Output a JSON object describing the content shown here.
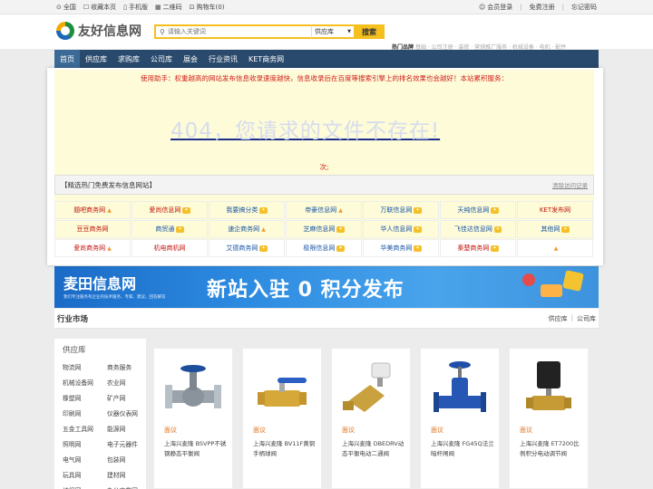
{
  "topbar": {
    "left": [
      "全国",
      "收藏本页",
      "手机版",
      "二维码",
      "购物车(0)"
    ],
    "right": [
      "会员登录",
      "免费注册",
      "忘记密码"
    ]
  },
  "header": {
    "logo_text": "友好信息网",
    "search_placeholder": "请输入关键词",
    "search_scope": "供应库",
    "search_button": "搜索",
    "hot_label": "热门品牌",
    "hot_keywords": "基础 · 公司注册 · 装修 · 营销推广服务 · 机械设备 · 电机 · 配件"
  },
  "nav": [
    "首页",
    "供应库",
    "求购库",
    "公司库",
    "展会",
    "行业资讯",
    "KET商务网"
  ],
  "notice": {
    "assist_text": "使用助手：权重越高的网站发布信息收录速度越快，信息收录后在百度等搜索引擎上的排名效果也会越好！本站累积服务：",
    "error_text": "404，您请求的文件不存在!",
    "count_text": "次;",
    "rec_title": "【精选热门免费发布信息网站】",
    "rec_clear": "清除访问记录"
  },
  "sites": [
    {
      "name": "题吧商务网",
      "mark": "up",
      "color": "red"
    },
    {
      "name": "爱尚信息网",
      "mark": "vip",
      "color": "red"
    },
    {
      "name": "我要搞分类",
      "mark": "vip",
      "color": "blue"
    },
    {
      "name": "帝豪信息网",
      "mark": "up",
      "color": "blue"
    },
    {
      "name": "万联信息网",
      "mark": "vip",
      "color": "blue"
    },
    {
      "name": "天纯信息网",
      "mark": "vip",
      "color": "blue"
    },
    {
      "name": "KET发布网",
      "mark": "",
      "color": "red"
    },
    {
      "name": "豆豆商务网",
      "mark": "",
      "color": "red"
    },
    {
      "name": "商贸通",
      "mark": "vip",
      "color": "blue"
    },
    {
      "name": "速企商务网",
      "mark": "up",
      "color": "blue"
    },
    {
      "name": "芝麻信息网",
      "mark": "vip",
      "color": "blue"
    },
    {
      "name": "华人信息网",
      "mark": "vip",
      "color": "blue"
    },
    {
      "name": "飞佳达信息网",
      "mark": "vip",
      "color": "blue"
    },
    {
      "name": "其他网",
      "mark": "vip",
      "color": "blue"
    },
    {
      "name": "爱尚商务网",
      "mark": "up",
      "color": "red"
    },
    {
      "name": "机电商机网",
      "mark": "",
      "color": "red"
    },
    {
      "name": "艾德商务网",
      "mark": "vip",
      "color": "blue"
    },
    {
      "name": "极限信息网",
      "mark": "vip",
      "color": "blue"
    },
    {
      "name": "华美商务网",
      "mark": "vip",
      "color": "blue"
    },
    {
      "name": "秦楚商务网",
      "mark": "vip",
      "color": "red"
    },
    {
      "name": "",
      "mark": "up",
      "color": "red"
    }
  ],
  "banner": {
    "brand": "麦田信息网",
    "tag": "我们专注服务有企业的技术服务、专家、建议、回答解答",
    "slogan_a": "新站入驻 ",
    "slogan_b": "0",
    "slogan_c": " 积分发布"
  },
  "market": {
    "title": "行业市场",
    "links": [
      "供应库",
      "公司库"
    ]
  },
  "sidebar": {
    "title": "供应库",
    "cats": [
      "物流网",
      "商务服务",
      "机械设备网",
      "农业网",
      "橡塑网",
      "矿产网",
      "印刷网",
      "仪器仪表网",
      "五金工具网",
      "能源网",
      "照明网",
      "电子元器件",
      "电气网",
      "包装网",
      "玩具网",
      "建材网",
      "纺织网",
      "办公文教网"
    ]
  },
  "products": [
    {
      "price": "面议",
      "name": "上海兴麦隆 BSVPP不锈钢静态平衡阀",
      "icon": "valve-flange-icon"
    },
    {
      "price": "面议",
      "name": "上海兴麦隆 BV11F黄铜手柄球阀",
      "icon": "ball-valve-icon"
    },
    {
      "price": "面议",
      "name": "上海兴麦隆 DBEDRV动态平衡电动二通阀",
      "icon": "electric-valve-icon"
    },
    {
      "price": "面议",
      "name": "上海兴麦隆 FG45Q法兰暗杆闸阀",
      "icon": "gate-valve-icon"
    },
    {
      "price": "面议",
      "name": "上海兴麦隆 ET7200比例积分电动调节阀",
      "icon": "actuator-icon"
    }
  ]
}
